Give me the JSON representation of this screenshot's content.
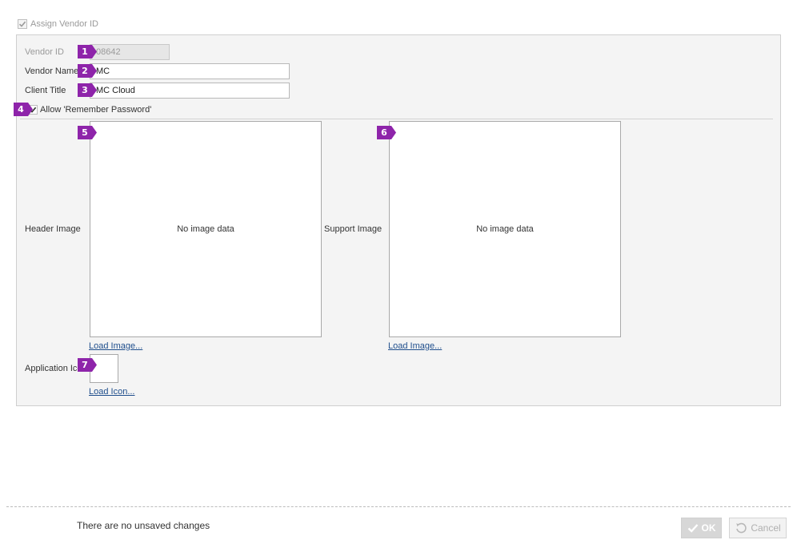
{
  "assign": {
    "label": "Assign Vendor ID",
    "checked": true
  },
  "form": {
    "vendor_id": {
      "label": "Vendor ID",
      "value": "08642"
    },
    "vendor_name": {
      "label": "Vendor Name",
      "value": "MC"
    },
    "client_title": {
      "label": "Client Title",
      "value": "MC Cloud"
    },
    "remember_password": {
      "label": "Allow 'Remember Password'",
      "checked": true
    },
    "header_image": {
      "label": "Header Image",
      "placeholder": "No image data",
      "load_label": "Load Image..."
    },
    "support_image": {
      "label": "Support Image",
      "placeholder": "No image data",
      "load_label": "Load Image..."
    },
    "application_icon": {
      "label": "Application Icon",
      "load_label": "Load Icon..."
    }
  },
  "badges": [
    "1",
    "2",
    "3",
    "4",
    "5",
    "6",
    "7"
  ],
  "badge_color": "#8e24aa",
  "footer": {
    "status": "There are no unsaved changes",
    "ok_label": "OK",
    "cancel_label": "Cancel"
  }
}
